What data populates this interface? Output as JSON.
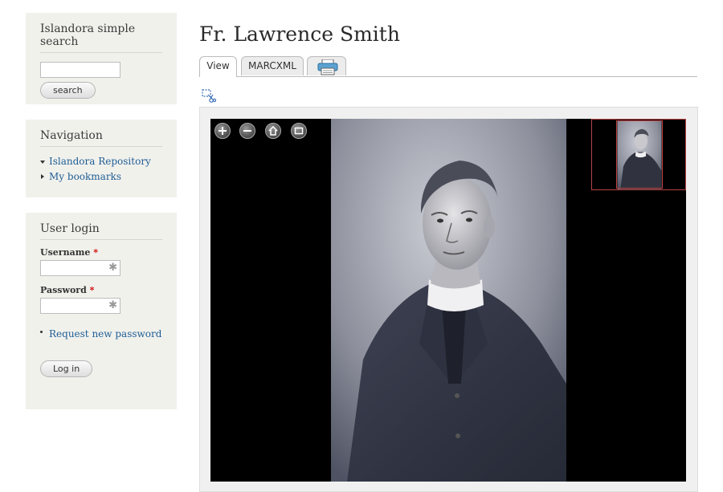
{
  "sidebar": {
    "search": {
      "title": "Islandora simple search",
      "input_value": "",
      "button_label": "search"
    },
    "navigation": {
      "title": "Navigation",
      "items": [
        {
          "label": "Islandora Repository",
          "state": "expanded"
        },
        {
          "label": "My bookmarks",
          "state": "collapsed"
        }
      ]
    },
    "login": {
      "title": "User login",
      "username_label": "Username",
      "password_label": "Password",
      "required_marker": "*",
      "request_password_link": "Request new password",
      "button_label": "Log in"
    }
  },
  "main": {
    "title": "Fr. Lawrence Smith",
    "tabs": [
      {
        "label": "View",
        "active": true
      },
      {
        "label": "MARCXML",
        "active": false
      },
      {
        "label": "",
        "icon": "printer-icon",
        "active": false
      }
    ],
    "viewer": {
      "controls": [
        "zoom-in-icon",
        "zoom-out-icon",
        "home-icon",
        "fullscreen-icon"
      ]
    }
  },
  "colors": {
    "link": "#1f5d95",
    "sidebar_bg": "#f1f1ec",
    "required": "#cc0000",
    "navigator_border": "#b54444"
  }
}
